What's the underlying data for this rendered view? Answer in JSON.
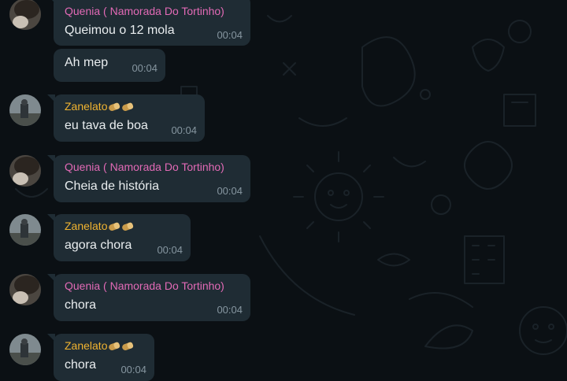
{
  "colors": {
    "background": "#0b1014",
    "bubble": "#1f2c34",
    "text": "#e9edef",
    "time": "#8696a0",
    "quenia_name": "#e26ab6",
    "zanelato_name": "#f0b330"
  },
  "messages": [
    {
      "sender": "Quenia ( Namorada Do Tortinho)",
      "text": "Queimou o 12 mola",
      "time": "00:04"
    },
    {
      "sender": "",
      "text": "Ah mep",
      "time": "00:04"
    },
    {
      "sender": "Zanelato",
      "sender_emoji": "pill-pill",
      "text": "eu tava de boa",
      "time": "00:04"
    },
    {
      "sender": "Quenia ( Namorada Do Tortinho)",
      "text": "Cheia de história",
      "time": "00:04"
    },
    {
      "sender": "Zanelato",
      "sender_emoji": "pill-pill",
      "text": "agora chora",
      "time": "00:04"
    },
    {
      "sender": "Quenia ( Namorada Do Tortinho)",
      "text": "chora",
      "time": "00:04"
    },
    {
      "sender": "Zanelato",
      "sender_emoji": "pill-pill",
      "text": "chora",
      "time": "00:04"
    }
  ]
}
